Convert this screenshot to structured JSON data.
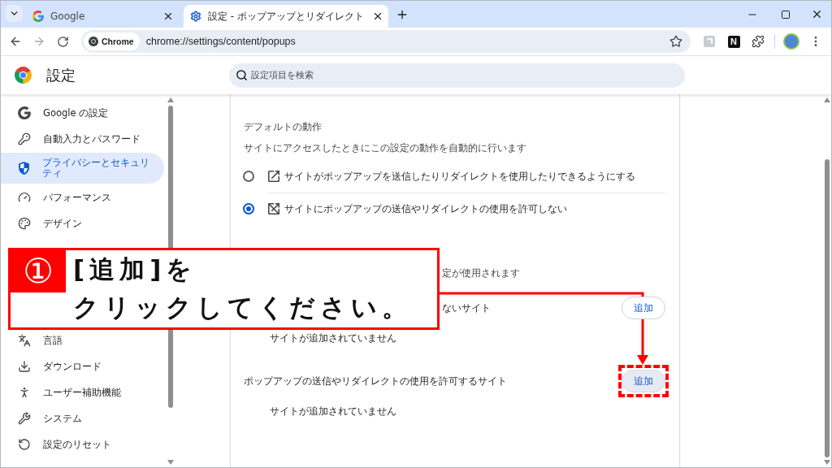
{
  "tabs": [
    {
      "title": "Google",
      "kind": "google",
      "selected": false
    },
    {
      "title": "設定 - ポップアップとリダイレクト",
      "kind": "settings",
      "selected": true
    }
  ],
  "toolbar": {
    "site_chip": "Chrome",
    "url": "chrome://settings/content/popups",
    "extension_badge": "N"
  },
  "settings_header": {
    "title": "設定",
    "search": {
      "placeholder": "設定項目を検索"
    }
  },
  "sidebar": {
    "groups": [
      {
        "items": [
          {
            "label": "Google の設定",
            "kind": "google",
            "selected": false
          },
          {
            "label": "自動入力とパスワード",
            "kind": "autofill",
            "selected": false
          },
          {
            "label": "プライバシーとセキュリティ",
            "kind": "privacy",
            "selected": true
          },
          {
            "label": "パフォーマンス",
            "kind": "performance",
            "selected": false
          },
          {
            "label": "デザイン",
            "kind": "appearance",
            "selected": false
          }
        ]
      },
      {
        "items": [
          {
            "label": "言語",
            "kind": "language",
            "selected": false
          },
          {
            "label": "ダウンロード",
            "kind": "downloads",
            "selected": false
          },
          {
            "label": "ユーザー補助機能",
            "kind": "accessibility",
            "selected": false
          },
          {
            "label": "システム",
            "kind": "system",
            "selected": false
          },
          {
            "label": "設定のリセット",
            "kind": "reset",
            "selected": false
          }
        ]
      }
    ]
  },
  "content": {
    "default_behavior": {
      "heading": "デフォルトの動作",
      "description": "サイトにアクセスしたときにこの設定の動作を自動的に行います",
      "options": [
        {
          "label": "サイトがポップアップを送信したりリダイレクトを使用したりできるようにする",
          "kind": "allow",
          "selected": false
        },
        {
          "label": "サイトにポップアップの送信やリダイレクトの使用を許可しない",
          "kind": "block",
          "selected": true
        }
      ]
    },
    "custom_behavior": {
      "description": "定が使用されます",
      "site_lists": [
        {
          "title": "ないサイト",
          "button": "追加",
          "empty_text": "サイトが追加されていません",
          "hovered": false,
          "marked": false
        },
        {
          "title": "ポップアップの送信やリダイレクトの使用を許可するサイト",
          "button": "追加",
          "empty_text": "サイトが追加されていません",
          "hovered": true,
          "marked": true
        }
      ]
    }
  },
  "annotation": {
    "step": "①",
    "lines": [
      "[追加]を",
      "クリックしてください。"
    ]
  }
}
